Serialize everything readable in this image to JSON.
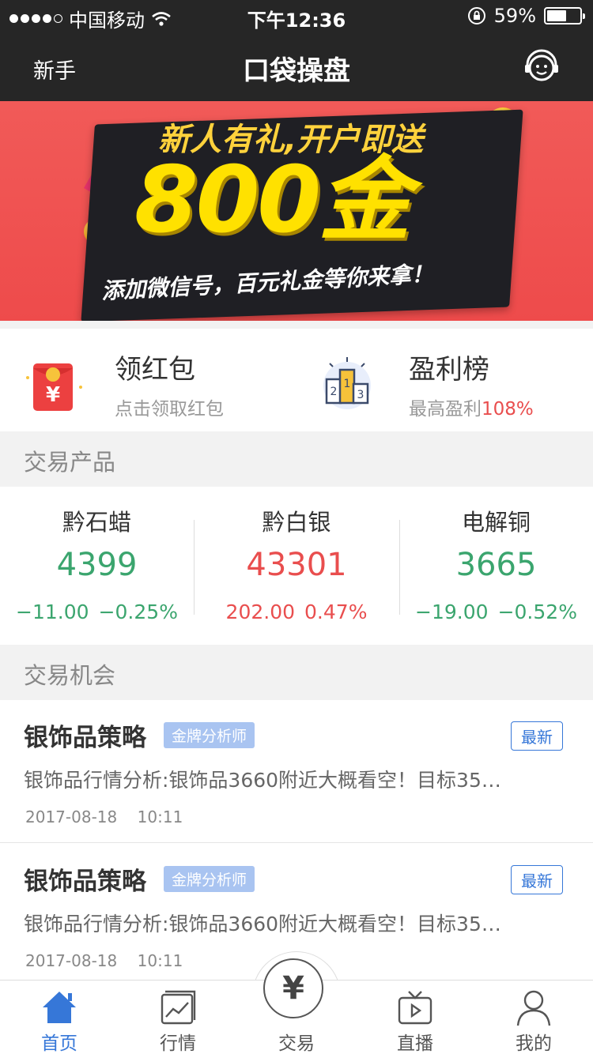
{
  "status_bar": {
    "carrier": "中国移动",
    "time": "下午12:36",
    "battery": "59%",
    "battery_level": 0.59,
    "icons": [
      "signal-dots-icon",
      "wifi-icon",
      "orientation-lock-icon",
      "battery-icon"
    ]
  },
  "nav": {
    "left_label": "新手",
    "title": "口袋操盘",
    "right_icon": "customer-service-icon"
  },
  "banner": {
    "line1": "新人有礼,开户即送",
    "amount": "800金",
    "line3": "添加微信号，百元礼金等你来拿！",
    "coin_symbol": "¥"
  },
  "promos": [
    {
      "title": "领红包",
      "subtitle": "点击领取红包",
      "icon": "red-envelope-icon",
      "icon_symbol": "¥"
    },
    {
      "title": "盈利榜",
      "subtitle_prefix": "最高盈利",
      "subtitle_highlight": "108%",
      "icon": "podium-icon",
      "podium": [
        "2",
        "1",
        "3"
      ]
    }
  ],
  "sections": {
    "products_title": "交易产品",
    "opportunities_title": "交易机会"
  },
  "products": [
    {
      "name": "黔石蜡",
      "price": "4399",
      "change": "−11.00",
      "change_pct": "−0.25%",
      "trend": "down"
    },
    {
      "name": "黔白银",
      "price": "43301",
      "change": "202.00",
      "change_pct": "0.47%",
      "trend": "up"
    },
    {
      "name": "电解铜",
      "price": "3665",
      "change": "−19.00",
      "change_pct": "−0.52%",
      "trend": "down"
    }
  ],
  "opportunities": [
    {
      "title": "银饰品策略",
      "tag": "金牌分析师",
      "badge": "最新",
      "desc": "银饰品行情分析:银饰品3660附近大概看空！目标35…",
      "date": "2017-08-18",
      "time": "10:11"
    },
    {
      "title": "银饰品策略",
      "tag": "金牌分析师",
      "badge": "最新",
      "desc": "银饰品行情分析:银饰品3660附近大概看空！目标35…",
      "date": "2017-08-18",
      "time": "10:11"
    }
  ],
  "tabs": [
    {
      "label": "首页",
      "icon": "home-icon",
      "active": true
    },
    {
      "label": "行情",
      "icon": "market-chart-icon",
      "active": false
    },
    {
      "label": "交易",
      "icon": "trade-yuan-icon",
      "active": false,
      "symbol": "¥"
    },
    {
      "label": "直播",
      "icon": "live-tv-icon",
      "active": false
    },
    {
      "label": "我的",
      "icon": "profile-icon",
      "active": false
    }
  ],
  "colors": {
    "dark_bar": "#262626",
    "banner_red": "#ee4b4b",
    "up_red": "#e94e4e",
    "down_green": "#3ba56e",
    "accent_blue": "#3677d8",
    "tag_blue": "#a9c4f1"
  }
}
